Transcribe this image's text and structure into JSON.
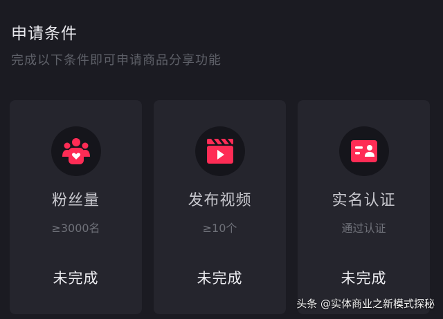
{
  "header": {
    "title": "申请条件",
    "subtitle": "完成以下条件即可申请商品分享功能"
  },
  "conditions": [
    {
      "icon": "fans-icon",
      "label": "粉丝量",
      "requirement": "≥3000名",
      "status": "未完成"
    },
    {
      "icon": "video-clapper-icon",
      "label": "发布视频",
      "requirement": "≥10个",
      "status": "未完成"
    },
    {
      "icon": "id-card-icon",
      "label": "实名认证",
      "requirement": "通过认证",
      "status": "未完成"
    }
  ],
  "watermark": "头条 @实体商业之新模式探秘",
  "colors": {
    "background": "#1b1b22",
    "card": "#25252d",
    "accent": "#fe2c55"
  }
}
